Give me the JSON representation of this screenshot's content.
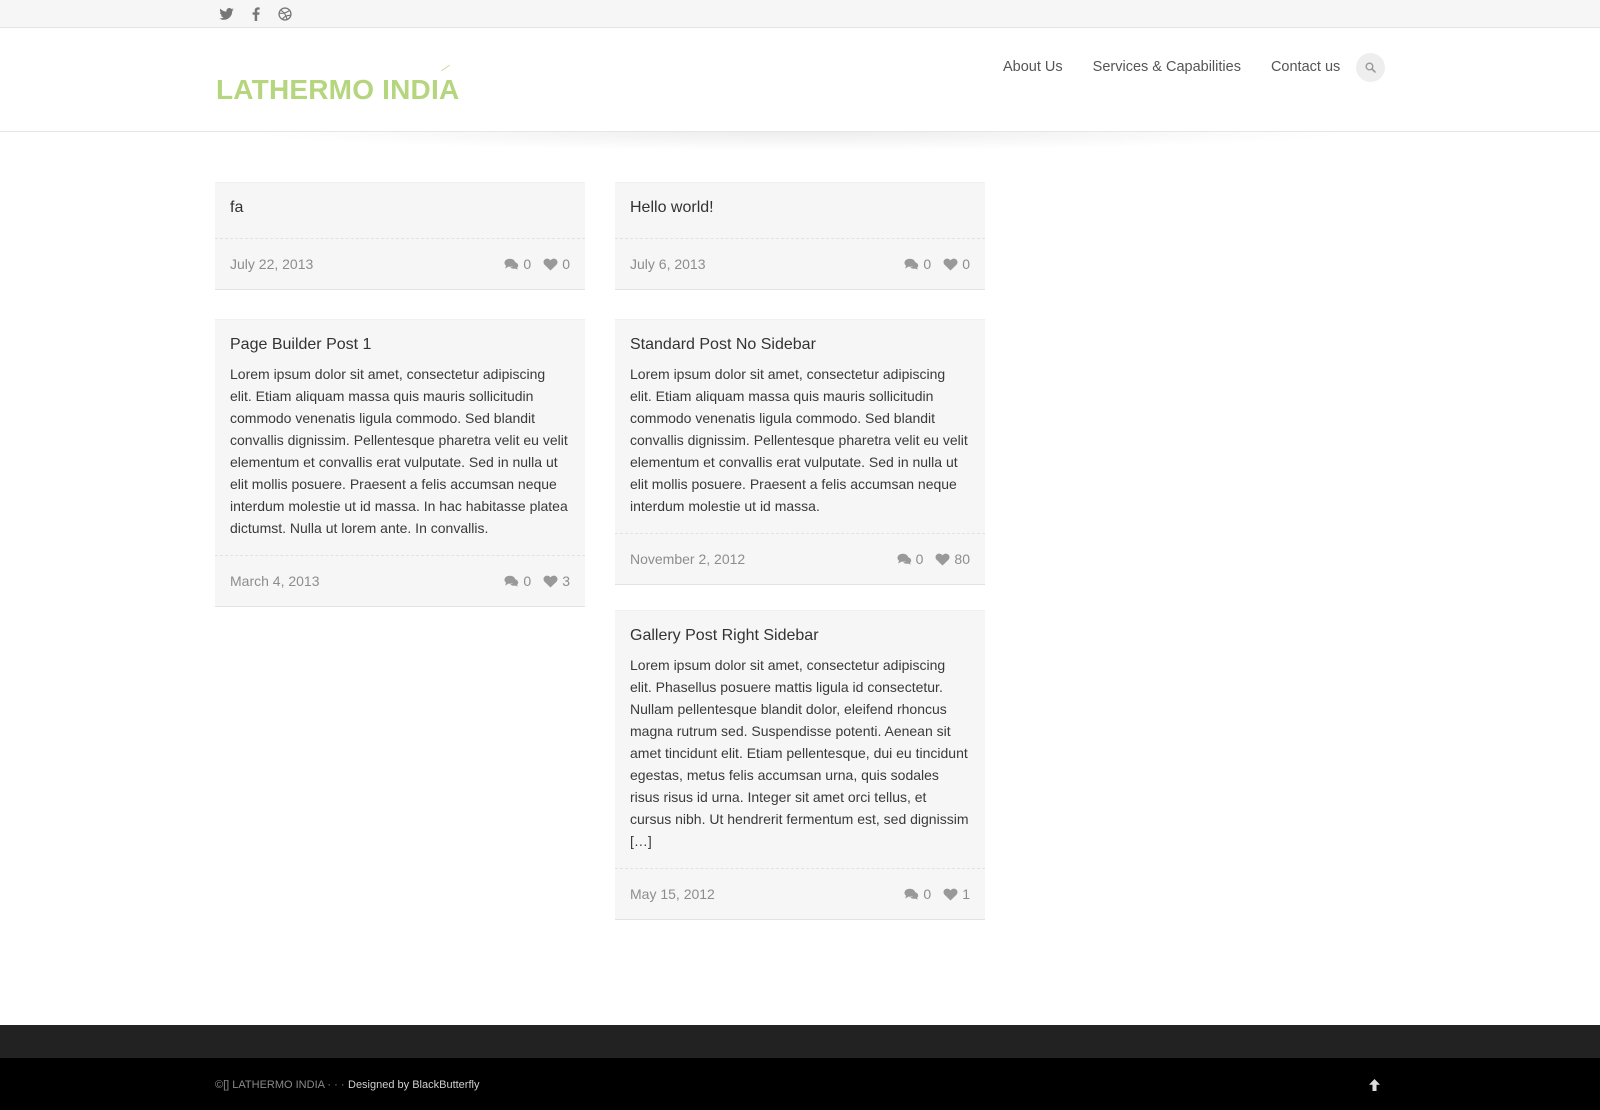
{
  "topbar": {
    "social": [
      {
        "icon": "twitter-icon"
      },
      {
        "icon": "facebook-icon"
      },
      {
        "icon": "dribbble-icon"
      }
    ]
  },
  "header": {
    "logo_text": "LATHERMO INDIA",
    "nav": [
      "About Us",
      "Services & Capabilities",
      "Contact us"
    ],
    "search_icon": "search-icon"
  },
  "posts": [
    {
      "title": "fa",
      "excerpt": "",
      "date": "July 22, 2013",
      "comments": "0",
      "likes": "0"
    },
    {
      "title": "Hello world!",
      "excerpt": "",
      "date": "July 6, 2013",
      "comments": "0",
      "likes": "0"
    },
    {
      "title": "Page Builder Post 1",
      "excerpt": "Lorem ipsum dolor sit amet, consectetur adipiscing elit. Etiam aliquam massa quis mauris sollicitudin commodo venenatis ligula commodo. Sed blandit convallis dignissim. Pellentesque pharetra velit eu velit elementum et convallis erat vulputate. Sed in nulla ut elit mollis posuere. Praesent a felis accumsan neque interdum molestie ut id massa. In hac habitasse platea dictumst. Nulla ut lorem ante. In convallis.",
      "date": "March 4, 2013",
      "comments": "0",
      "likes": "3"
    },
    {
      "title": "Standard Post No Sidebar",
      "excerpt": "Lorem ipsum dolor sit amet, consectetur adipiscing elit. Etiam aliquam massa quis mauris sollicitudin commodo venenatis ligula commodo. Sed blandit convallis dignissim. Pellentesque pharetra velit eu velit elementum et convallis erat vulputate. Sed in nulla ut elit mollis posuere. Praesent a felis accumsan neque interdum molestie ut id massa.",
      "date": "November 2, 2012",
      "comments": "0",
      "likes": "80"
    },
    {
      "title": "Gallery Post Right Sidebar",
      "excerpt": "Lorem ipsum dolor sit amet, consectetur adipiscing elit. Phasellus posuere mattis ligula id consectetur. Nullam pellentesque blandit dolor, eleifend rhoncus magna rutrum sed. Suspendisse potenti. Aenean sit amet tincidunt elit. Etiam pellentesque, dui eu tincidunt egestas, metus felis accumsan urna, quis sodales risus risus id urna. Integer sit amet orci tellus, et cursus nibh. Ut hendrerit fermentum est, sed dignissim […]",
      "date": "May 15, 2012",
      "comments": "0",
      "likes": "1"
    }
  ],
  "footer": {
    "copyright": "©[] LATHERMO INDIA · · ·",
    "designed_by_prefix": "Designed by ",
    "designed_by_brand": "BlackButterfly",
    "back_to_top_icon": "arrow-up-icon"
  },
  "colors": {
    "logo": "#b5d57e",
    "card_bg": "#f6f6f6",
    "footer_top": "#222222",
    "footer": "#000000"
  }
}
